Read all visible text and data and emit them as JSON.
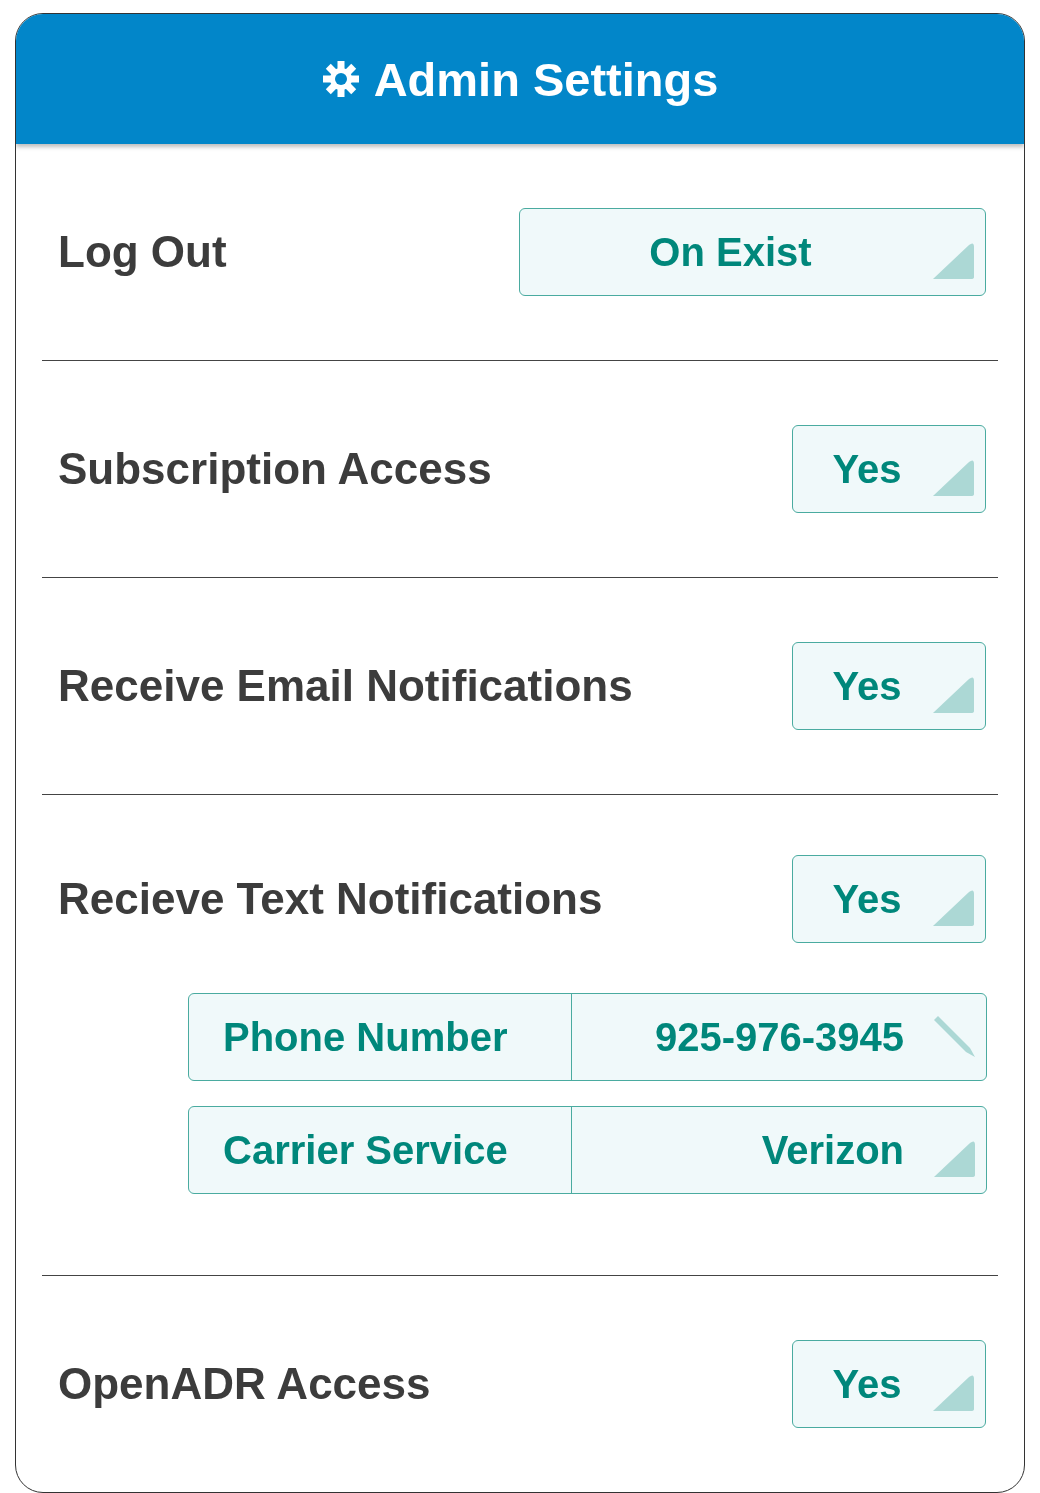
{
  "header": {
    "title": "Admin Settings"
  },
  "settings": [
    {
      "label": "Log Out",
      "control": {
        "kind": "dropdown",
        "value": "On Exist"
      }
    },
    {
      "label": "Subscription Access",
      "control": {
        "kind": "dropdown",
        "value": "Yes"
      }
    },
    {
      "label": "Receive Email Notifications",
      "control": {
        "kind": "dropdown",
        "value": "Yes"
      }
    },
    {
      "label": "Recieve Text Notifications",
      "control": {
        "kind": "dropdown",
        "value": "Yes"
      },
      "fields": [
        {
          "label": "Phone Number",
          "kind": "edit",
          "value": "925-976-3945"
        },
        {
          "label": "Carrier Service",
          "kind": "dropdown",
          "value": "Verizon"
        }
      ]
    },
    {
      "label": "OpenADR Access",
      "control": {
        "kind": "dropdown",
        "value": "Yes"
      }
    }
  ]
}
